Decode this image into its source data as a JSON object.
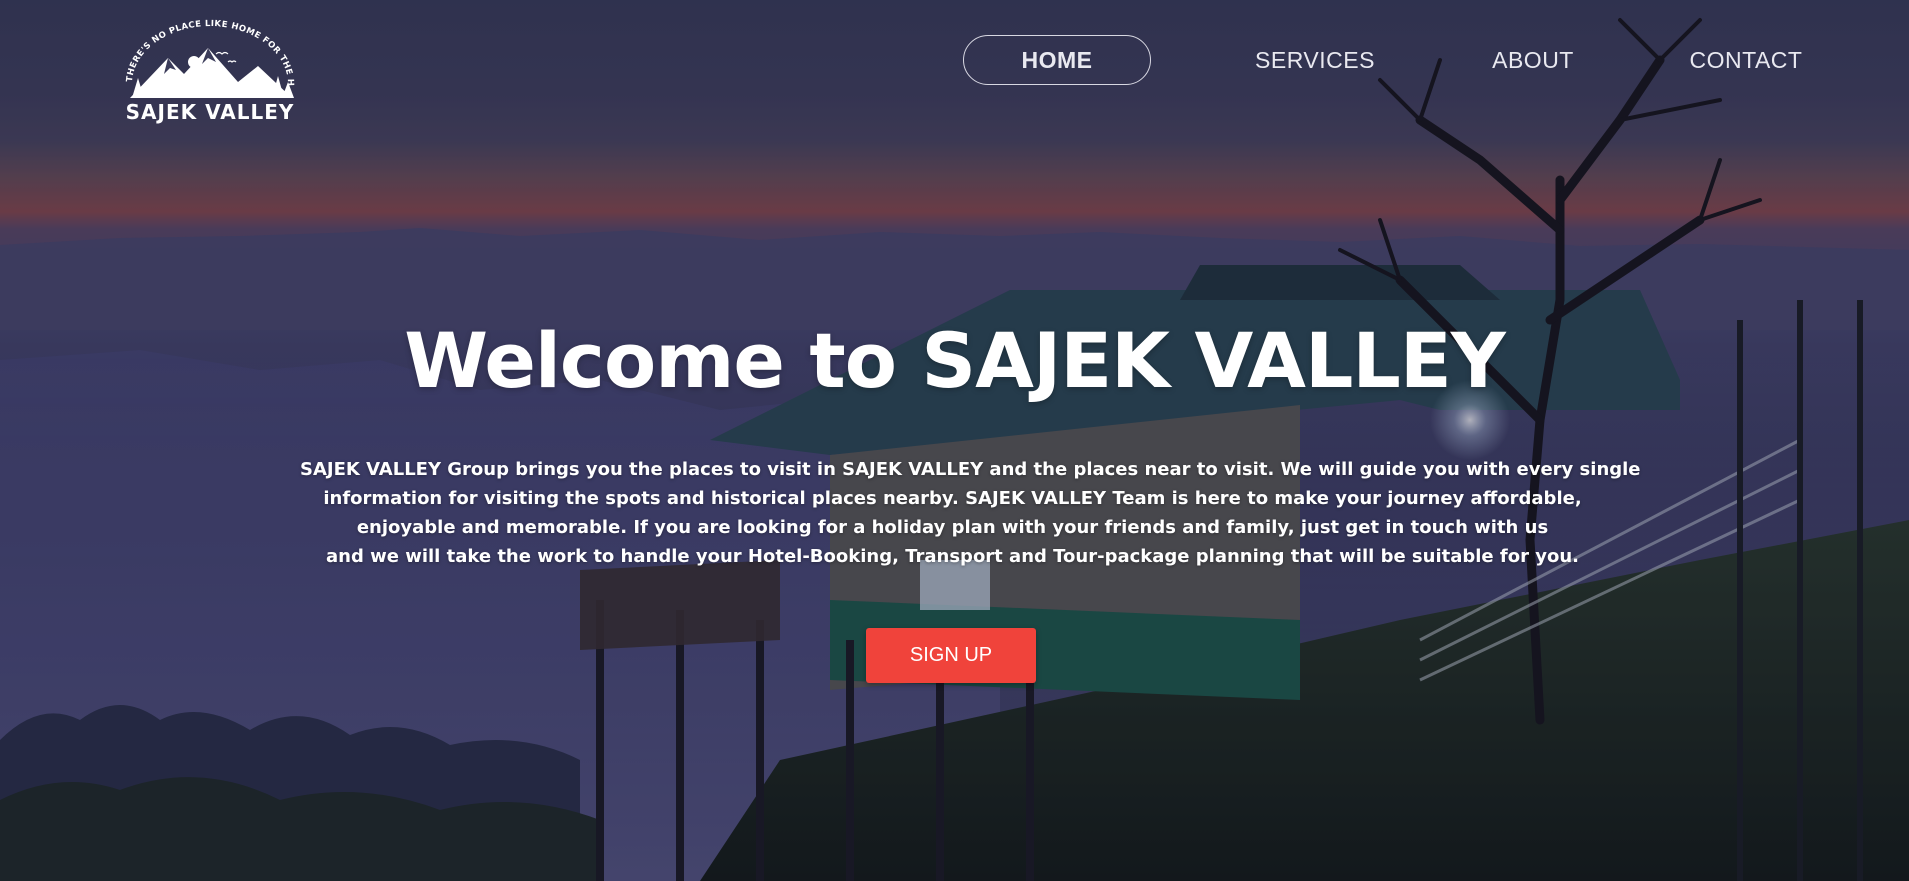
{
  "logo": {
    "tagline": "THERE'S NO PLACE LIKE HOME FOR THE HOLIDAYS",
    "name": "SAJEK VALLEY"
  },
  "nav": {
    "items": [
      {
        "label": "HOME",
        "active": true
      },
      {
        "label": "SERVICES"
      },
      {
        "label": "ABOUT"
      },
      {
        "label": "CONTACT"
      }
    ]
  },
  "hero": {
    "headline": "Welcome to SAJEK VALLEY",
    "description_lines": [
      "SAJEK VALLEY Group brings you the places to visit in SAJEK VALLEY and the places near to visit. We will guide you with every single",
      "information for visiting the spots and historical places nearby. SAJEK VALLEY Team is here to make your journey affordable,",
      "enjoyable and memorable. If you are looking for a holiday plan with your friends and family, just get in touch with us",
      "and we will take the work to handle your Hotel-Booking, Transport and Tour-package planning that will be suitable for you."
    ],
    "cta_label": "SIGN UP"
  },
  "colors": {
    "accent": "#f0433b",
    "text": "#ffffff",
    "nav_text": "#e9e9f0"
  }
}
